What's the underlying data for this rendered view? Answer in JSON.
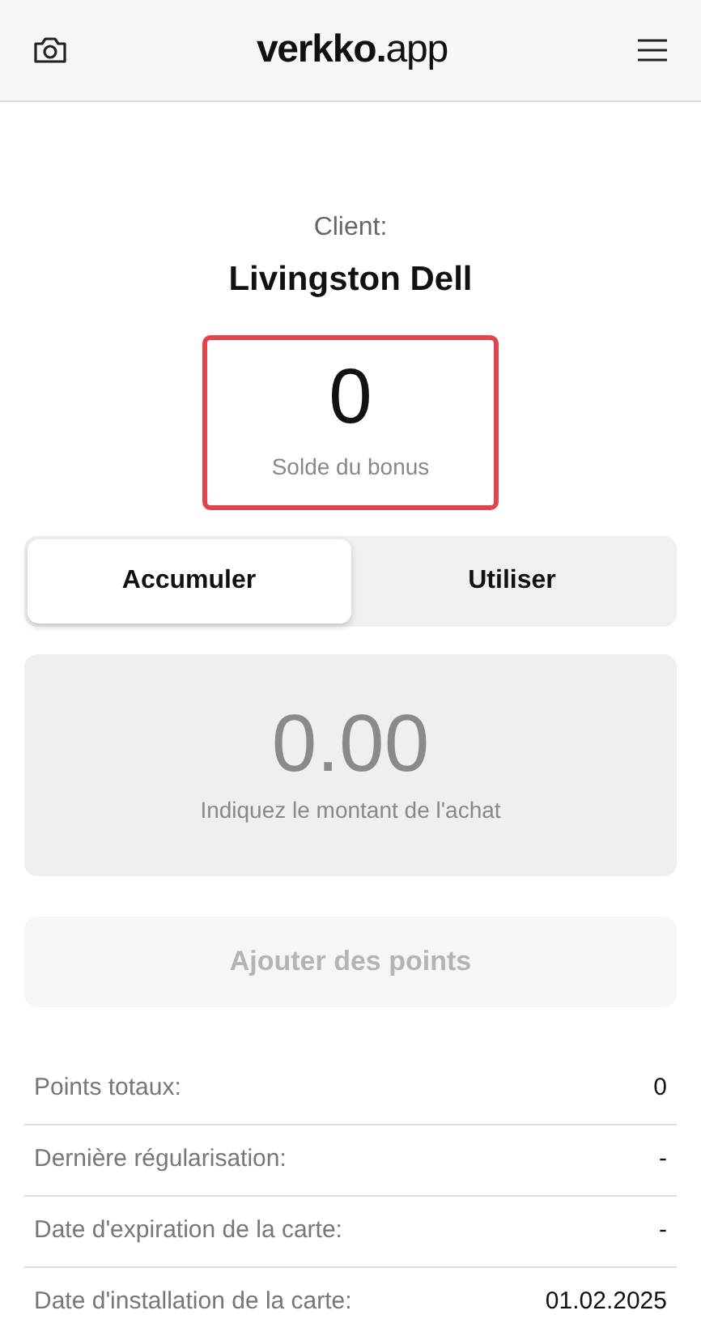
{
  "header": {
    "logo": "**verkko.**app"
  },
  "client": {
    "label": "Client:",
    "name": "Livingston Dell"
  },
  "bonus": {
    "value": "0",
    "label": "Solde du bonus"
  },
  "tabs": [
    {
      "label": "Accumuler",
      "selected": true
    },
    {
      "label": "Utiliser",
      "selected": false
    }
  ],
  "amount": {
    "value": "0.00",
    "hint": "Indiquez le montant de l'achat"
  },
  "add_button": {
    "label": "Ajouter des points",
    "disabled": true
  },
  "details": [
    {
      "label": "Points totaux:",
      "value": "0"
    },
    {
      "label": "Dernière régularisation:",
      "value": "-"
    },
    {
      "label": "Date d'expiration de la carte:",
      "value": "-"
    },
    {
      "label": "Date d'installation de la carte:",
      "value": "01.02.2025"
    }
  ]
}
